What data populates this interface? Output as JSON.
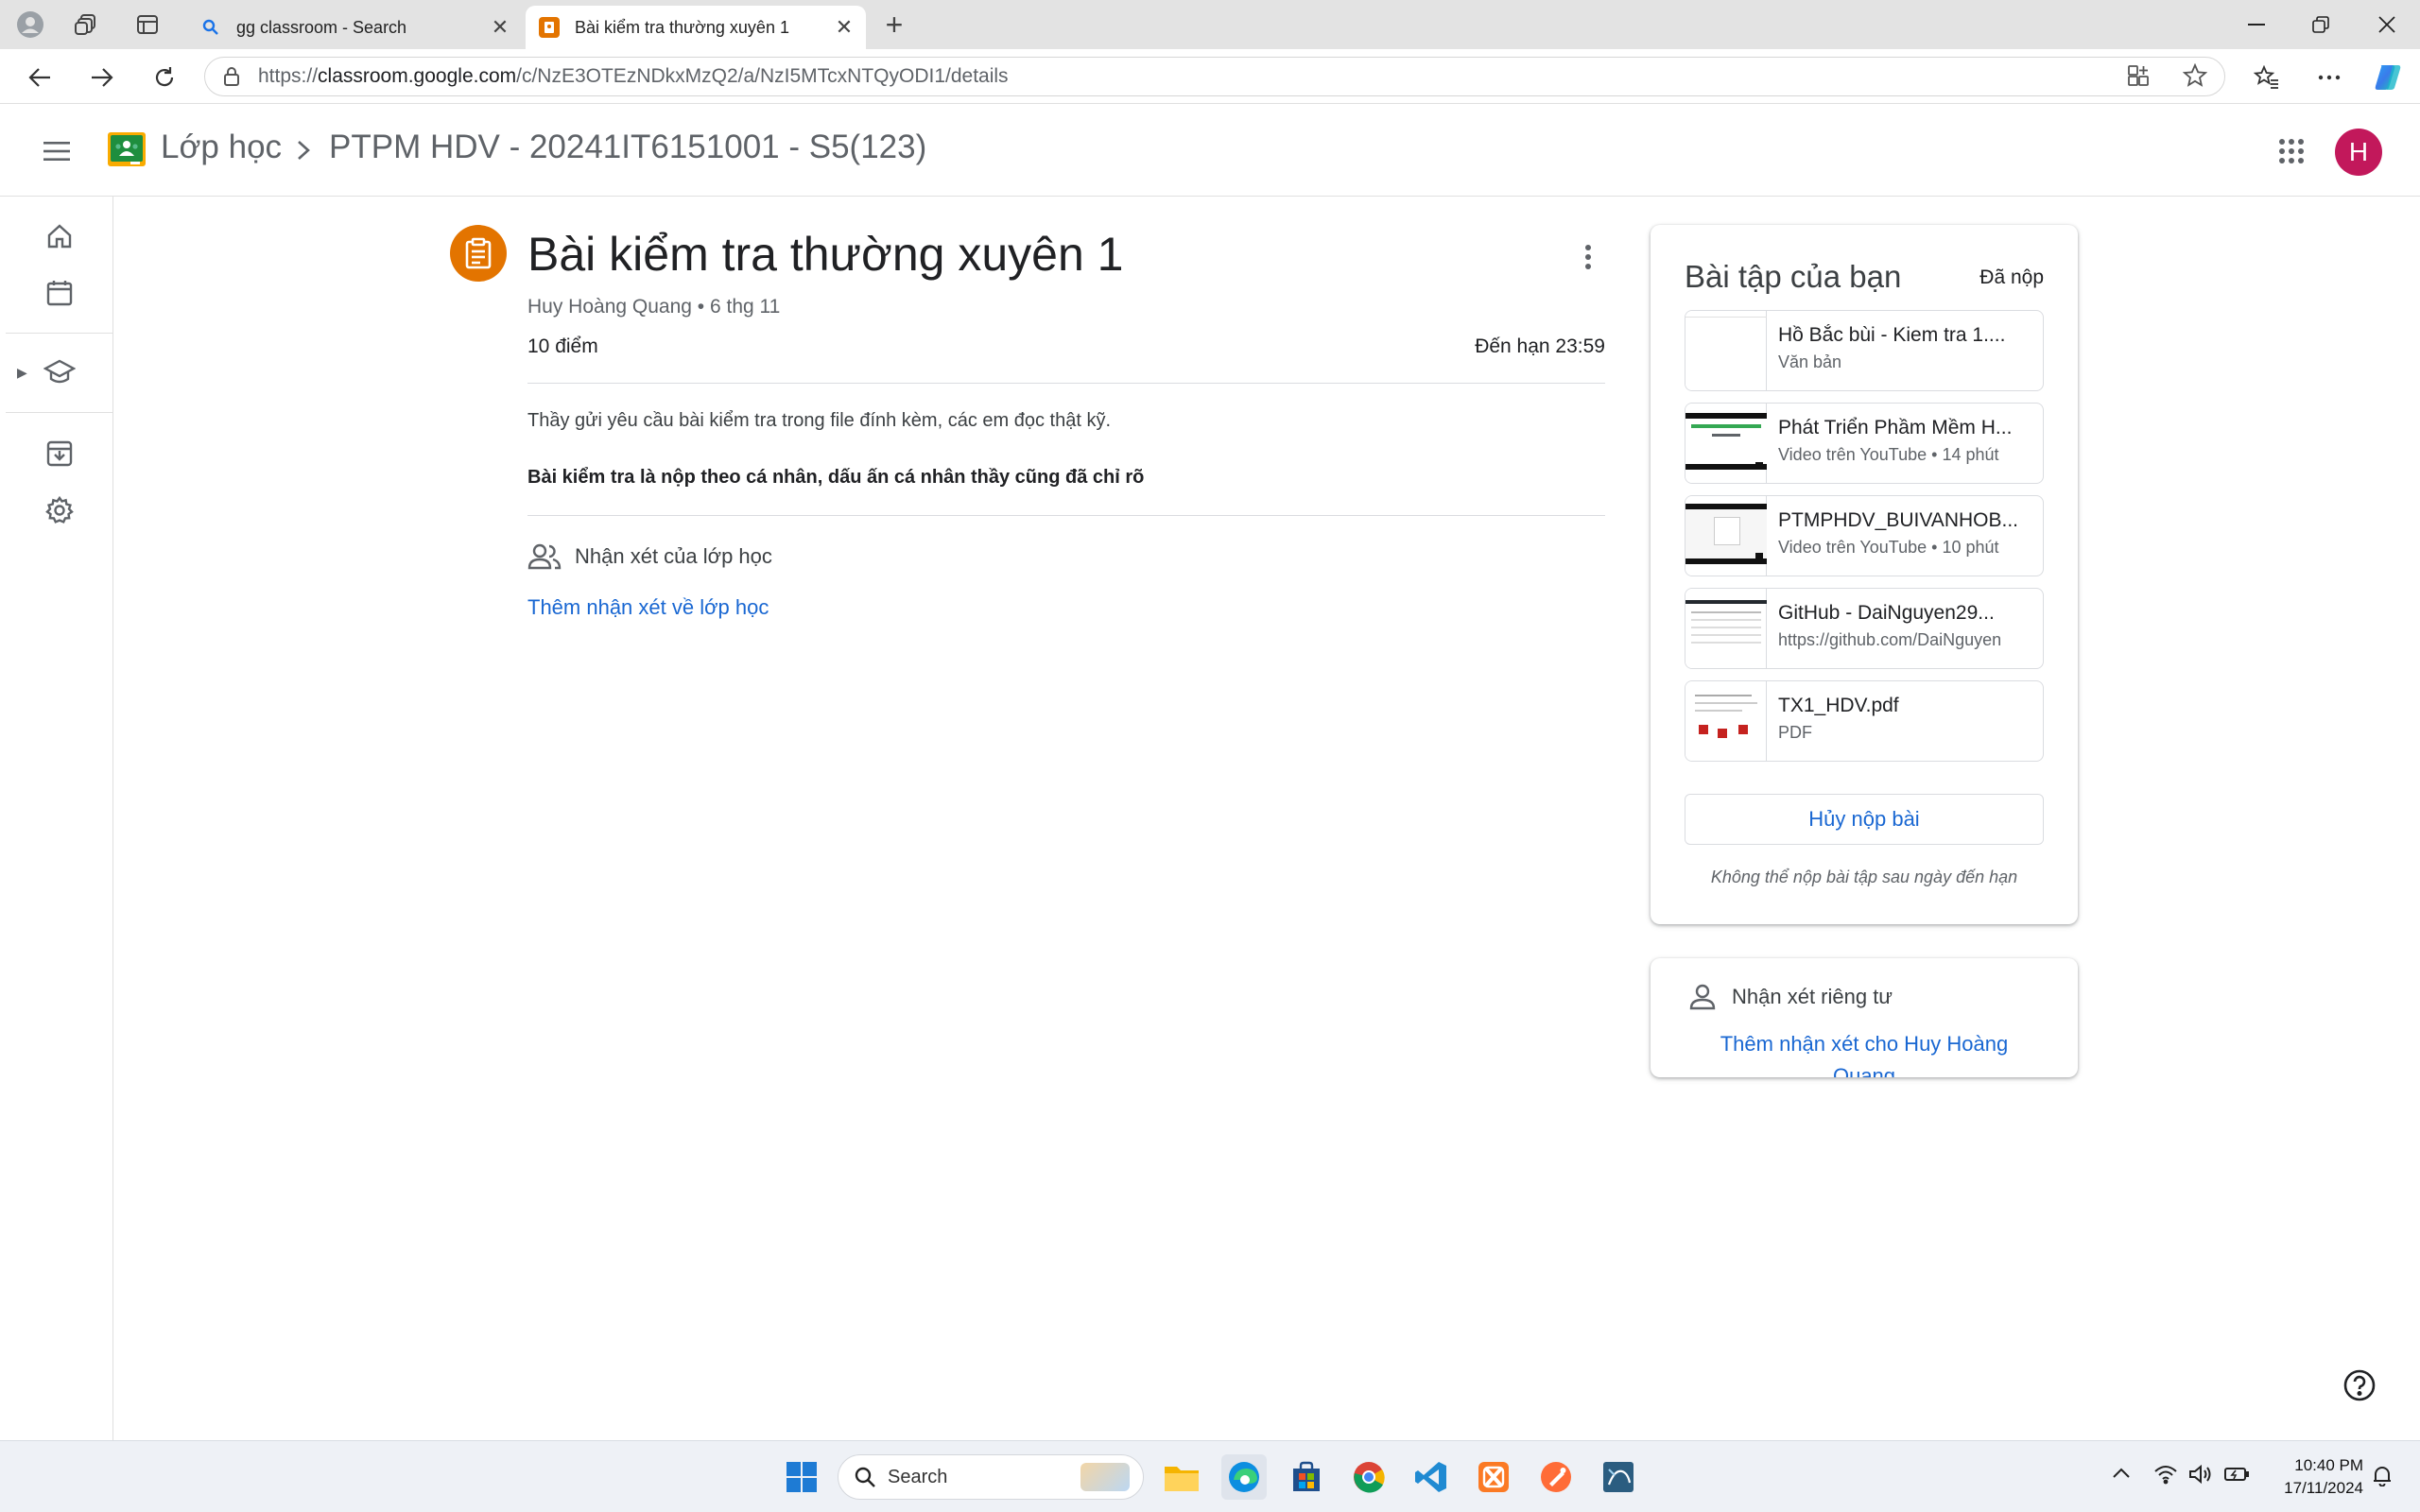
{
  "browser": {
    "tabs": [
      {
        "label": "gg classroom - Search",
        "active": false
      },
      {
        "label": "Bài kiểm tra thường xuyên 1",
        "active": true
      }
    ],
    "url_prefix": "https://",
    "url_host": "classroom.google.com",
    "url_path": "/c/NzE3OTEzNDkxMzQ2/a/NzI5MTcxNTQyODI1/details"
  },
  "header": {
    "app_title": "Lớp học",
    "class_title": "PTPM HDV - 20241IT6151001 - S5(123)",
    "avatar_letter": "H",
    "avatar_color": "#c2185b"
  },
  "assignment": {
    "title": "Bài kiểm tra thường xuyên 1",
    "meta": "Huy Hoàng Quang • 6 thg 11",
    "points": "10 điểm",
    "due": "Đến hạn 23:59",
    "description": "Thầy gửi yêu cầu bài kiểm tra trong file đính kèm, các em đọc thật kỹ.",
    "description_bold": "Bài kiểm tra là nộp theo cá nhân, dấu ấn cá nhân thầy cũng đã chỉ rõ",
    "class_comments_label": "Nhận xét của lớp học",
    "add_class_comment": "Thêm nhận xét về lớp học",
    "accent": "#e37400"
  },
  "your_work": {
    "title": "Bài tập của bạn",
    "status": "Đã nộp",
    "attachments": [
      {
        "name": "Hồ Bắc bùi - Kiem tra 1....",
        "sub": "Văn bản"
      },
      {
        "name": "Phát Triển Phầm Mềm H...",
        "sub": "Video trên YouTube • 14 phút"
      },
      {
        "name": "PTMPHDV_BUIVANHOB...",
        "sub": "Video trên YouTube • 10 phút"
      },
      {
        "name": "GitHub - DaiNguyen29...",
        "sub": "https://github.com/DaiNguyen"
      },
      {
        "name": "TX1_HDV.pdf",
        "sub": "PDF"
      }
    ],
    "unsubmit_label": "Hủy nộp bài",
    "late_note": "Không thể nộp bài tập sau ngày đến hạn"
  },
  "private_comments": {
    "title": "Nhận xét riêng tư",
    "add_label": "Thêm nhận xét cho Huy Hoàng Quang"
  },
  "taskbar": {
    "search_placeholder": "Search",
    "time": "10:40 PM",
    "date": "17/11/2024"
  },
  "colors": {
    "link": "#1967d2",
    "classroom_green": "#1e8e3e"
  }
}
